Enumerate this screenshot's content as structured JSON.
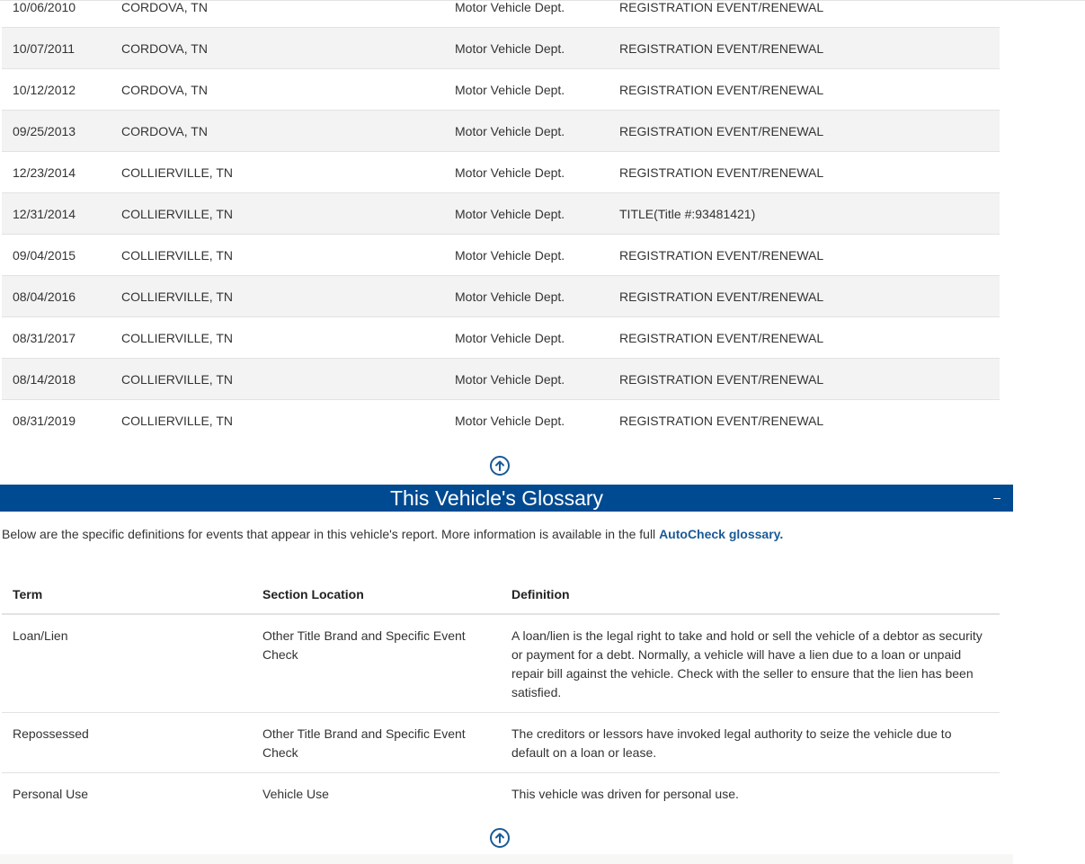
{
  "events": [
    {
      "date": "10/06/2010",
      "location": "CORDOVA, TN",
      "source": "Motor Vehicle Dept.",
      "detail": "REGISTRATION EVENT/RENEWAL"
    },
    {
      "date": "10/07/2011",
      "location": "CORDOVA, TN",
      "source": "Motor Vehicle Dept.",
      "detail": "REGISTRATION EVENT/RENEWAL"
    },
    {
      "date": "10/12/2012",
      "location": "CORDOVA, TN",
      "source": "Motor Vehicle Dept.",
      "detail": "REGISTRATION EVENT/RENEWAL"
    },
    {
      "date": "09/25/2013",
      "location": "CORDOVA, TN",
      "source": "Motor Vehicle Dept.",
      "detail": "REGISTRATION EVENT/RENEWAL"
    },
    {
      "date": "12/23/2014",
      "location": "COLLIERVILLE, TN",
      "source": "Motor Vehicle Dept.",
      "detail": "REGISTRATION EVENT/RENEWAL"
    },
    {
      "date": "12/31/2014",
      "location": "COLLIERVILLE, TN",
      "source": "Motor Vehicle Dept.",
      "detail": "TITLE(Title #:93481421)"
    },
    {
      "date": "09/04/2015",
      "location": "COLLIERVILLE, TN",
      "source": "Motor Vehicle Dept.",
      "detail": "REGISTRATION EVENT/RENEWAL"
    },
    {
      "date": "08/04/2016",
      "location": "COLLIERVILLE, TN",
      "source": "Motor Vehicle Dept.",
      "detail": "REGISTRATION EVENT/RENEWAL"
    },
    {
      "date": "08/31/2017",
      "location": "COLLIERVILLE, TN",
      "source": "Motor Vehicle Dept.",
      "detail": "REGISTRATION EVENT/RENEWAL"
    },
    {
      "date": "08/14/2018",
      "location": "COLLIERVILLE, TN",
      "source": "Motor Vehicle Dept.",
      "detail": "REGISTRATION EVENT/RENEWAL"
    },
    {
      "date": "08/31/2019",
      "location": "COLLIERVILLE, TN",
      "source": "Motor Vehicle Dept.",
      "detail": "REGISTRATION EVENT/RENEWAL"
    }
  ],
  "glossary": {
    "title": "This Vehicle's Glossary",
    "collapse_label": "–",
    "intro_text": "Below are the specific definitions for events that appear in this vehicle's report. More information is available in the full ",
    "intro_link": "AutoCheck glossary.",
    "headers": {
      "term": "Term",
      "section": "Section Location",
      "definition": "Definition"
    },
    "rows": [
      {
        "term": "Loan/Lien",
        "section": "Other Title Brand and Specific Event Check",
        "definition": "A loan/lien is the legal right to take and hold or sell the vehicle of a debtor as security or payment for a debt. Normally, a vehicle will have a lien due to a loan or unpaid repair bill against the vehicle. Check with the seller to ensure that the lien has been satisfied."
      },
      {
        "term": "Repossessed",
        "section": "Other Title Brand and Specific Event Check",
        "definition": "The creditors or lessors have invoked legal authority to seize the vehicle due to default on a loan or lease."
      },
      {
        "term": "Personal Use",
        "section": "Vehicle Use",
        "definition": "This vehicle was driven for personal use."
      }
    ]
  },
  "colors": {
    "accent": "#004a91",
    "link": "#1a5a96"
  },
  "icons": {
    "back_to_top": "arrow-up-circle-icon"
  }
}
